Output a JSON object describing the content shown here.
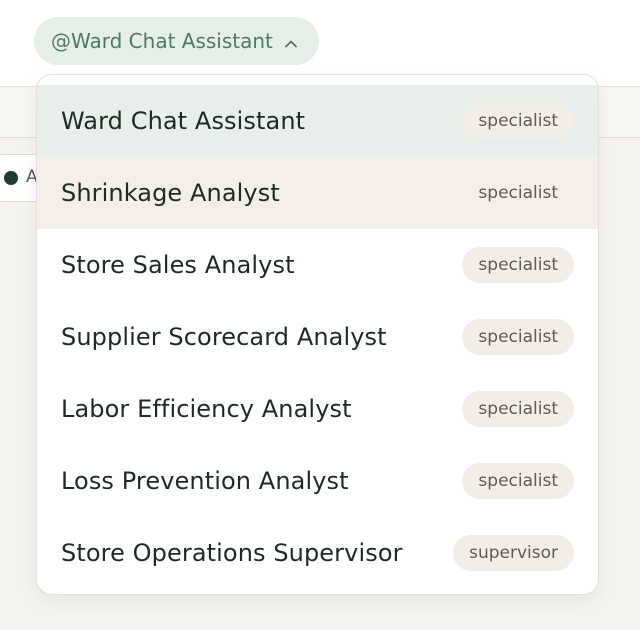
{
  "trigger": {
    "label": "@Ward Chat Assistant",
    "icon": "chevron-up-icon"
  },
  "background": {
    "chip_text": "A"
  },
  "menu": {
    "items": [
      {
        "label": "Ward Chat Assistant",
        "role": "specialist",
        "state": "selected"
      },
      {
        "label": "Shrinkage Analyst",
        "role": "specialist",
        "state": "hovered"
      },
      {
        "label": "Store Sales Analyst",
        "role": "specialist",
        "state": ""
      },
      {
        "label": "Supplier Scorecard Analyst",
        "role": "specialist",
        "state": ""
      },
      {
        "label": "Labor Efficiency Analyst",
        "role": "specialist",
        "state": ""
      },
      {
        "label": "Loss Prevention Analyst",
        "role": "specialist",
        "state": ""
      },
      {
        "label": "Store Operations Supervisor",
        "role": "supervisor",
        "state": ""
      }
    ]
  },
  "colors": {
    "trigger_bg": "#e6eee8",
    "trigger_text": "#4d7a61",
    "selected_bg": "#e8efea",
    "hover_bg": "#f2efe9",
    "badge_bg": "#f1eee8"
  }
}
